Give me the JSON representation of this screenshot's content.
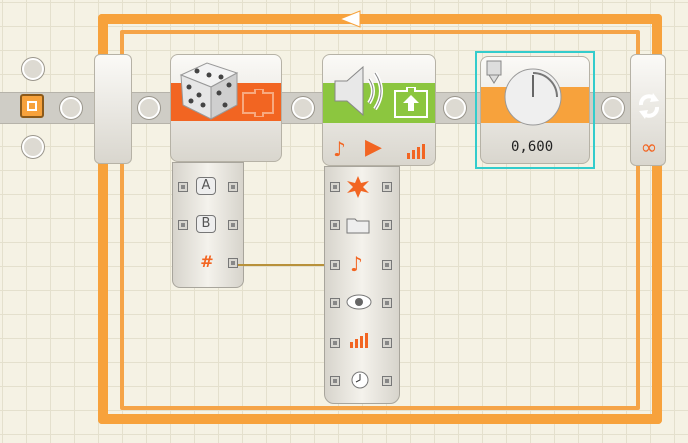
{
  "program": {
    "wait_block": {
      "value": "0,600"
    },
    "loop": {
      "infinity_symbol": "∞"
    },
    "random_block": {
      "ports": [
        {
          "name": "A"
        },
        {
          "name": "B"
        },
        {
          "name": "#"
        }
      ]
    },
    "sound_block": {
      "ports": [
        "action-icon",
        "file-icon",
        "tone-icon",
        "control-icon",
        "volume-icon",
        "duration-icon"
      ]
    },
    "colors": {
      "accent_orange": "#f7a23c",
      "random_orange": "#f26522",
      "sound_green": "#8cc63f",
      "selection_cyan": "#33cccc",
      "wire": "#b8913a"
    }
  }
}
